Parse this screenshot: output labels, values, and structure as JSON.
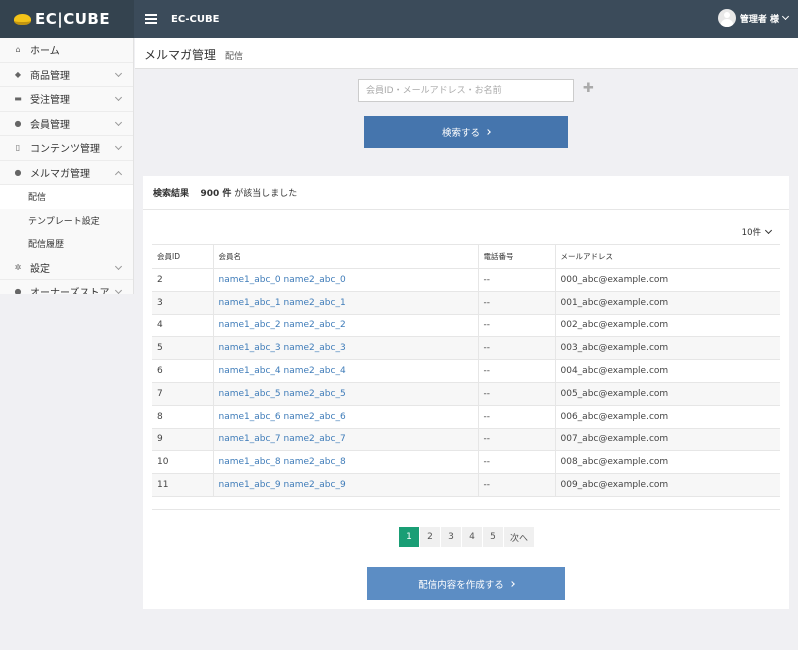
{
  "header": {
    "logo_text": "EC|CUBE",
    "site_name": "EC-CUBE",
    "user_name": "管理者 様"
  },
  "sidebar": {
    "items": [
      {
        "label": "ホーム",
        "icon": "home-icon"
      },
      {
        "label": "商品管理",
        "icon": "tag-icon"
      },
      {
        "label": "受注管理",
        "icon": "cart-icon"
      },
      {
        "label": "会員管理",
        "icon": "users-icon"
      },
      {
        "label": "コンテンツ管理",
        "icon": "file-icon"
      },
      {
        "label": "メルマガ管理",
        "icon": "comment-icon"
      }
    ],
    "sub_items": [
      {
        "label": "配信"
      },
      {
        "label": "テンプレート設定"
      },
      {
        "label": "配信履歴"
      }
    ],
    "items_after": [
      {
        "label": "設定",
        "icon": "gear-icon"
      },
      {
        "label": "オーナーズストア",
        "icon": "info-icon"
      }
    ]
  },
  "page": {
    "title": "メルマガ管理",
    "subtitle": "配信"
  },
  "search": {
    "placeholder": "会員ID・メールアドレス・お名前",
    "button_label": "検索する"
  },
  "results": {
    "label": "検索結果",
    "count": "900 件",
    "suffix": "が該当しました",
    "per_page": "10件"
  },
  "table": {
    "headers": [
      "会員ID",
      "会員名",
      "電話番号",
      "メールアドレス"
    ],
    "rows": [
      {
        "id": "2",
        "name": "name1_abc_0 name2_abc_0",
        "tel": "--",
        "email": "000_abc@example.com"
      },
      {
        "id": "3",
        "name": "name1_abc_1 name2_abc_1",
        "tel": "--",
        "email": "001_abc@example.com"
      },
      {
        "id": "4",
        "name": "name1_abc_2 name2_abc_2",
        "tel": "--",
        "email": "002_abc@example.com"
      },
      {
        "id": "5",
        "name": "name1_abc_3 name2_abc_3",
        "tel": "--",
        "email": "003_abc@example.com"
      },
      {
        "id": "6",
        "name": "name1_abc_4 name2_abc_4",
        "tel": "--",
        "email": "004_abc@example.com"
      },
      {
        "id": "7",
        "name": "name1_abc_5 name2_abc_5",
        "tel": "--",
        "email": "005_abc@example.com"
      },
      {
        "id": "8",
        "name": "name1_abc_6 name2_abc_6",
        "tel": "--",
        "email": "006_abc@example.com"
      },
      {
        "id": "9",
        "name": "name1_abc_7 name2_abc_7",
        "tel": "--",
        "email": "007_abc@example.com"
      },
      {
        "id": "10",
        "name": "name1_abc_8 name2_abc_8",
        "tel": "--",
        "email": "008_abc@example.com"
      },
      {
        "id": "11",
        "name": "name1_abc_9 name2_abc_9",
        "tel": "--",
        "email": "009_abc@example.com"
      }
    ]
  },
  "pagination": {
    "pages": [
      "1",
      "2",
      "3",
      "4",
      "5"
    ],
    "current": "1",
    "next_label": "次へ"
  },
  "create_button_label": "配信内容を作成する",
  "colors": {
    "header_bg": "#3b4b5a",
    "primary_button": "#4575ad",
    "secondary_button": "#5c8dc4",
    "active_page": "#1a9e75",
    "link": "#3f7cb9"
  }
}
